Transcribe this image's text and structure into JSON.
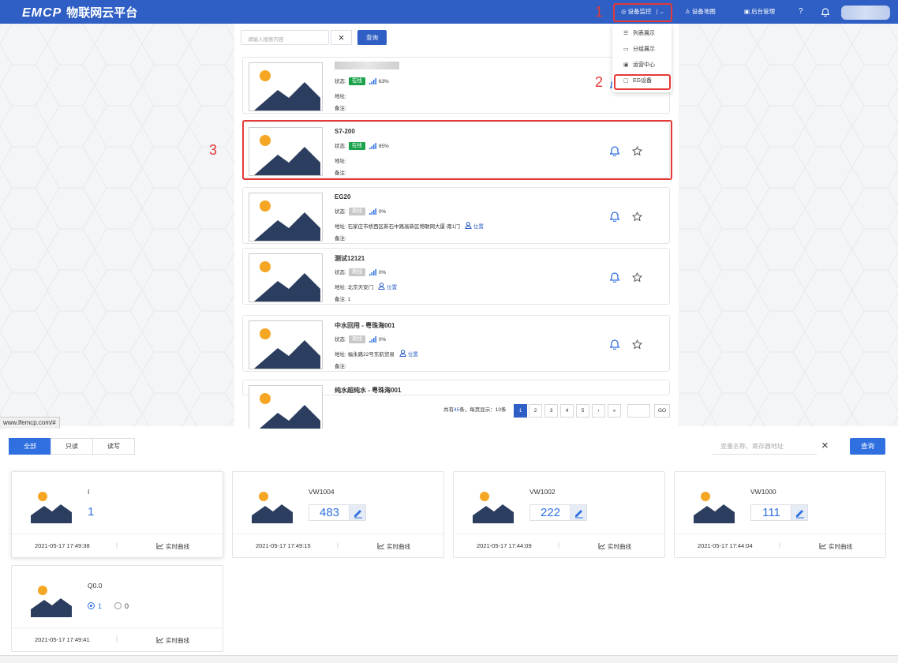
{
  "header": {
    "logo": "EMCP",
    "logo_sub": "物联网云平台",
    "nav_monitor": "设备监控",
    "nav_map": "设备地图",
    "nav_admin": "后台管理"
  },
  "annotations": {
    "n1": "1",
    "n2": "2",
    "n3": "3"
  },
  "search": {
    "placeholder": "请输入搜索内容",
    "clear": "×",
    "query": "查询"
  },
  "dropdown": [
    "列表展示",
    "分组展示",
    "运营中心",
    "EG设备"
  ],
  "labels": {
    "status": "状态:",
    "address": "地址:",
    "remark": "备注:",
    "position": "位置"
  },
  "devices": [
    {
      "name": "",
      "status": "在线",
      "online": true,
      "signal": "63%",
      "address": "",
      "remark": ""
    },
    {
      "name": "S7-200",
      "status": "在线",
      "online": true,
      "signal": "85%",
      "address": "",
      "remark": ""
    },
    {
      "name": "EG20",
      "status": "离线",
      "online": false,
      "signal": "0%",
      "address": "石家庄市桥西区新石中路高新区物联网大厦-南1门",
      "remark": ""
    },
    {
      "name": "测试12121",
      "status": "离线",
      "online": false,
      "signal": "0%",
      "address": "北京天安门",
      "remark": "1"
    },
    {
      "name": "中水回用 - 粤珠海001",
      "status": "离线",
      "online": false,
      "signal": "0%",
      "address": "福永路22号东航贸易",
      "remark": ""
    },
    {
      "name": "纯水超纯水 - 粤珠海001"
    }
  ],
  "pagination": {
    "total_prefix": "共有",
    "total": "45",
    "total_suffix": "条，每页显示：",
    "per_page": "10条",
    "pages": [
      "1",
      "2",
      "3",
      "4",
      "5"
    ],
    "next": "›",
    "last": "»",
    "go": "GO"
  },
  "statusbar": "www.lfemcp.com/#",
  "filter_tabs": [
    "全部",
    "只读",
    "读写"
  ],
  "var_search": {
    "placeholder": "变量名称、寄存器地址",
    "clear": "×",
    "query": "查询"
  },
  "variables": [
    {
      "name": "I",
      "value": "1",
      "editable": false,
      "time": "2021-05-17 17:49:38"
    },
    {
      "name": "VW1004",
      "value": "483",
      "editable": true,
      "time": "2021-05-17 17:49:15"
    },
    {
      "name": "VW1002",
      "value": "222",
      "editable": true,
      "time": "2021-05-17 17:44:09"
    },
    {
      "name": "VW1000",
      "value": "111",
      "editable": true,
      "time": "2021-05-17 17:44:04"
    },
    {
      "name": "Q0.0",
      "radio_on": "1",
      "radio_off": "0",
      "time": "2021-05-17 17:49:41"
    }
  ],
  "curve_label": "实时曲线",
  "colors": {
    "primary": "#2f5fc4",
    "online": "#1aa34a",
    "offline": "#c8c8c8",
    "annotation": "#e53935",
    "sun": "#f5a623",
    "mountain": "#2c3e5f"
  }
}
